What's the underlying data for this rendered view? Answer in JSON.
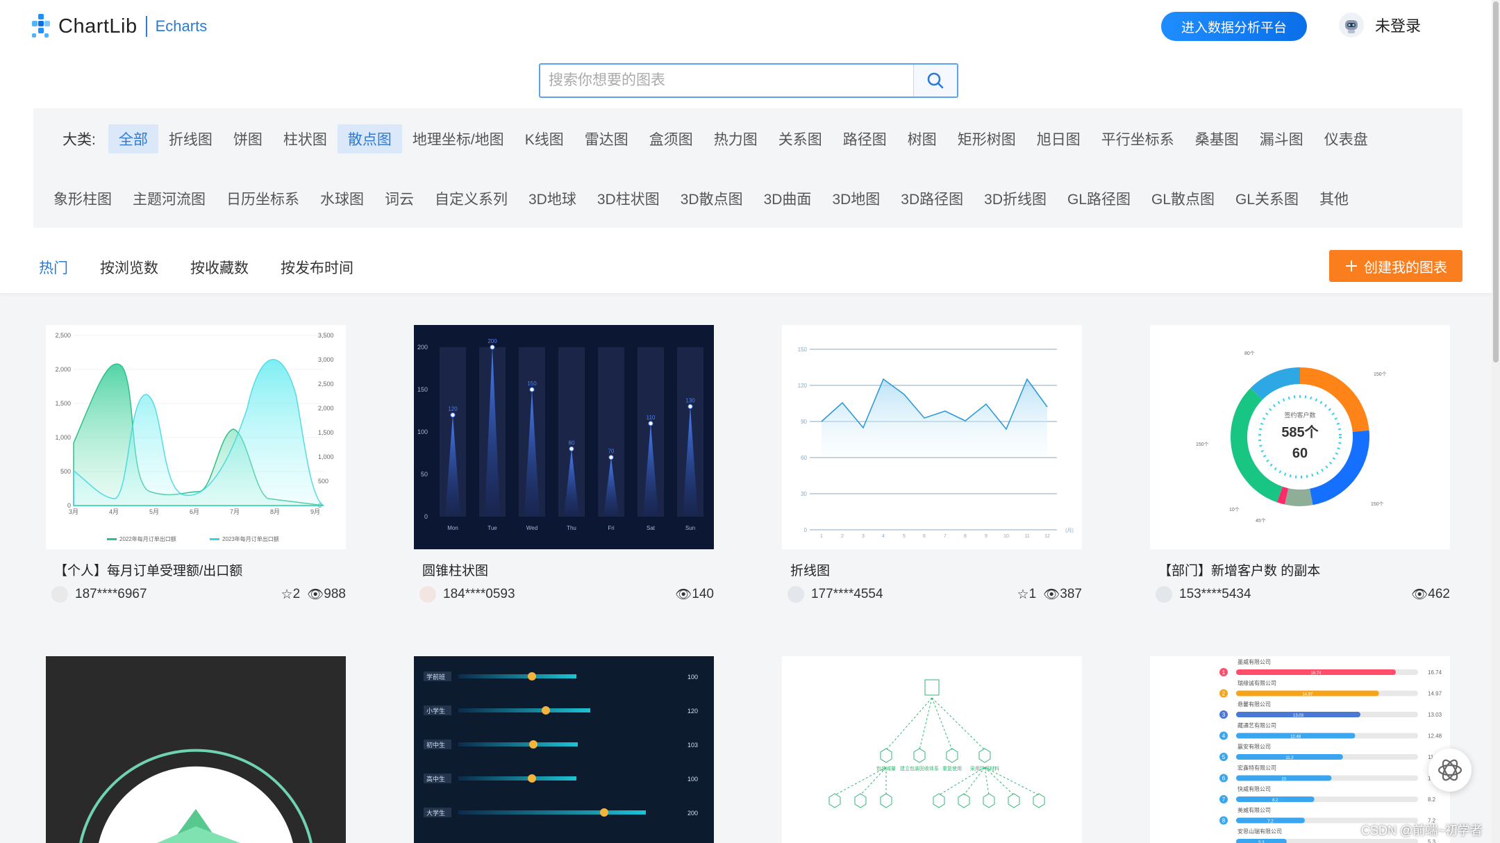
{
  "header": {
    "brand": "ChartLib",
    "brand_sub": "Echarts",
    "cta_label": "进入数据分析平台",
    "user_label": "未登录"
  },
  "search": {
    "placeholder": "搜索你想要的图表",
    "value": ""
  },
  "categories": {
    "label": "大类:",
    "row1": [
      "全部",
      "折线图",
      "饼图",
      "柱状图",
      "散点图",
      "地理坐标/地图",
      "K线图",
      "雷达图",
      "盒须图",
      "热力图",
      "关系图",
      "路径图",
      "树图",
      "矩形树图",
      "旭日图",
      "平行坐标系",
      "桑基图",
      "漏斗图",
      "仪表盘"
    ],
    "row2": [
      "象形柱图",
      "主题河流图",
      "日历坐标系",
      "水球图",
      "词云",
      "自定义系列",
      "3D地球",
      "3D柱状图",
      "3D散点图",
      "3D曲面",
      "3D地图",
      "3D路径图",
      "3D折线图",
      "GL路径图",
      "GL散点图",
      "GL关系图",
      "其他"
    ]
  },
  "sorts": [
    "热门",
    "按浏览数",
    "按收藏数",
    "按发布时间"
  ],
  "create_label": "创建我的图表",
  "cards": [
    {
      "title": "【个人】每月订单受理额/出口额",
      "user": "187****6967",
      "stars": "2",
      "views": "988"
    },
    {
      "title": "圆锥柱状图",
      "user": "184****0593",
      "stars": "",
      "views": "140"
    },
    {
      "title": "折线图",
      "user": "177****4554",
      "stars": "1",
      "views": "387"
    },
    {
      "title": "【部门】新增客户数 的副本",
      "user": "153****5434",
      "stars": "",
      "views": "462"
    }
  ],
  "thumbs": {
    "area": {
      "y1": [
        "2,500",
        "2,000",
        "1,500",
        "1,000",
        "500",
        "0"
      ],
      "y2": [
        "3,500",
        "3,000",
        "2,500",
        "2,000",
        "1,500",
        "1,000",
        "500",
        "0"
      ],
      "x": [
        "3月",
        "4月",
        "5月",
        "6月",
        "7月",
        "8月",
        "9月"
      ],
      "legend": [
        "2022年每月订单出口额",
        "2023年每月订单出口额"
      ]
    },
    "cone": {
      "y": [
        "200",
        "150",
        "100",
        "50",
        "0"
      ],
      "x": [
        "Mon",
        "Tue",
        "Wed",
        "Thu",
        "Fri",
        "Sat",
        "Sun"
      ],
      "values": [
        120,
        200,
        150,
        80,
        70,
        110,
        130
      ]
    },
    "line": {
      "y": [
        "150",
        "120",
        "90",
        "60",
        "30",
        "0"
      ],
      "x": [
        "1",
        "2",
        "3",
        "4",
        "5",
        "6",
        "7",
        "8",
        "9",
        "10",
        "11",
        "12"
      ],
      "unit": "(月)"
    },
    "donut": {
      "center1": "签约客户数",
      "center2": "585个",
      "center3": "60",
      "labels": [
        "80个",
        "150个",
        "150个",
        "150个",
        "10个",
        "45个"
      ]
    },
    "bars": {
      "labels": [
        "学前班",
        "小学生",
        "初中生",
        "高中生",
        "大学生"
      ],
      "values": [
        "100",
        "120",
        "103",
        "100",
        "200"
      ]
    },
    "rank": {
      "companies": [
        "墨威有限公司",
        "瑞缘诚有限公司",
        "悬馨有限公司",
        "藏通艺有限公司",
        "赢安有限公司",
        "宏鑫特有限公司",
        "快威有限公司",
        "美威有限公司",
        "安思山瑞有限公司"
      ],
      "values": [
        "16.74",
        "14.97",
        "13.03",
        "12.48",
        "11.2",
        "10",
        "8.2",
        "7.2",
        "5.3"
      ],
      "ranks": [
        "1",
        "2",
        "3",
        "4",
        "5",
        "6",
        "7",
        "8"
      ]
    },
    "tree": {
      "mid": [
        "包装减量",
        "建立包装回收体系",
        "重复使用",
        "采用环保材料"
      ]
    }
  },
  "watermark": "CSDN @前端~初学者"
}
